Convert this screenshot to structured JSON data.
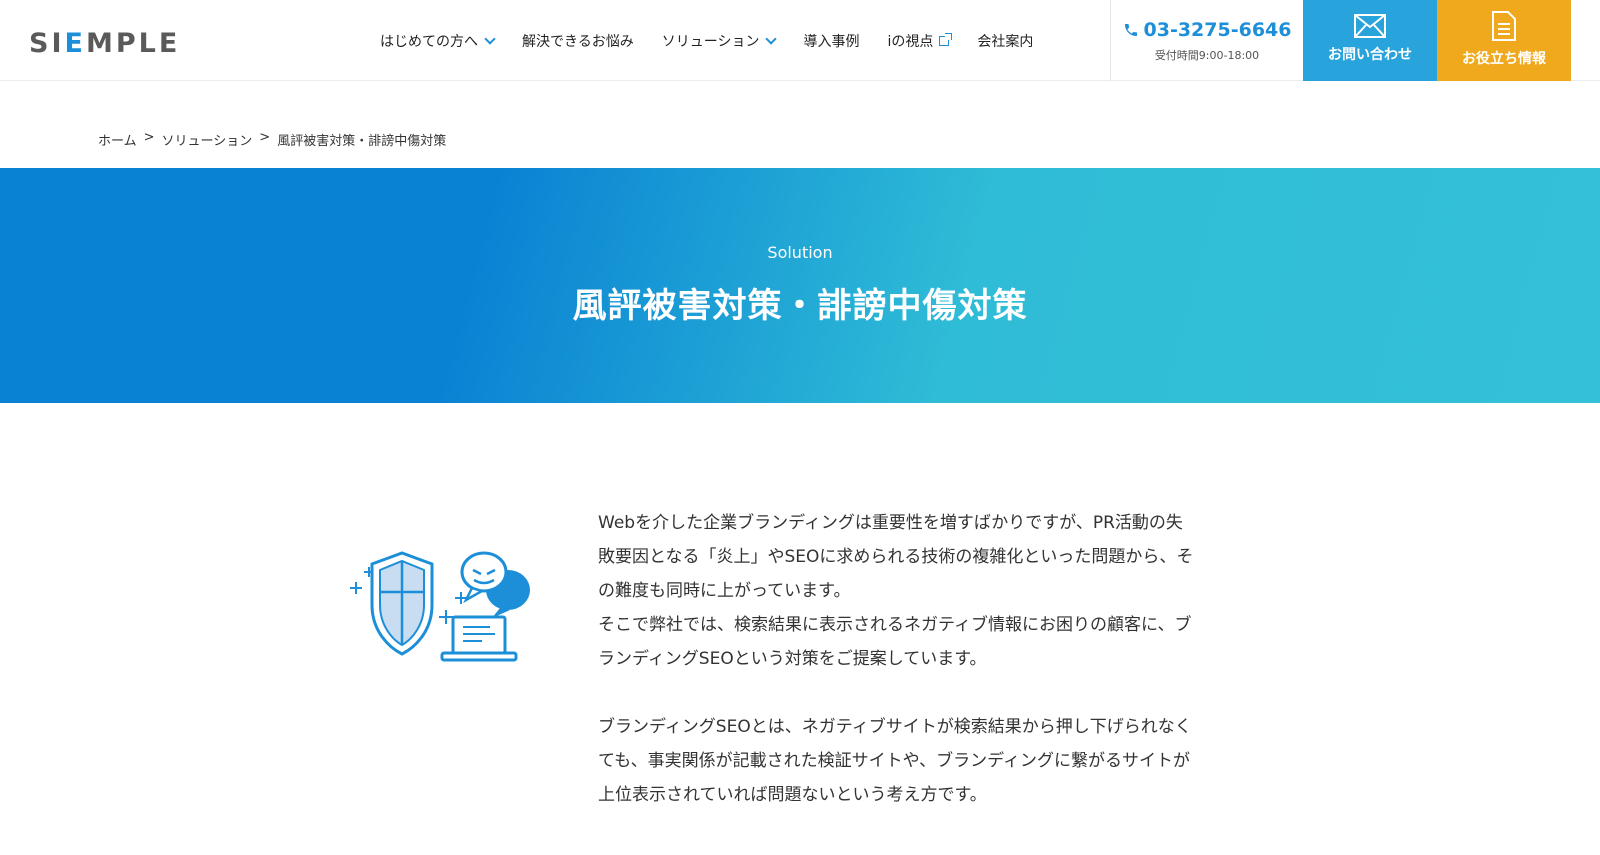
{
  "header": {
    "logo": {
      "pre": "SI",
      "accent": "E",
      "post": "MPLE"
    },
    "nav": [
      {
        "label": "はじめての方へ",
        "has_dropdown": true
      },
      {
        "label": "解決できるお悩み",
        "has_dropdown": false
      },
      {
        "label": "ソリューション",
        "has_dropdown": true
      },
      {
        "label": "導入事例",
        "has_dropdown": false
      },
      {
        "label": "iの視点",
        "external": true
      },
      {
        "label": "会社案内",
        "has_dropdown": false
      }
    ],
    "phone": {
      "number": "03-3275-6646",
      "hours": "受付時間9:00-18:00"
    },
    "contact_label": "お問い合わせ",
    "info_label": "お役立ち情報"
  },
  "breadcrumb": [
    "ホーム",
    "ソリューション",
    "風評被害対策・誹謗中傷対策"
  ],
  "breadcrumb_separator": ">",
  "hero": {
    "subtitle": "Solution",
    "title": "風評被害対策・誹謗中傷対策"
  },
  "body": {
    "paragraph1_lines": [
      "Webを介した企業ブランディングは重要性を増すばかりですが、PR活動の失",
      "敗要因となる「炎上」やSEOに求められる技術の複雑化といった問題から、そ",
      "の難度も同時に上がっています。",
      "そこで弊社では、検索結果に表示されるネガティブ情報にお困りの顧客に、ブ",
      "ランディングSEOという対策をご提案しています。"
    ],
    "paragraph2_lines": [
      "ブランディングSEOとは、ネガティブサイトが検索結果から押し下げられなく",
      "ても、事実関係が記載された検証サイトや、ブランディングに繋がるサイトが",
      "上位表示されていれば問題ないという考え方です。"
    ]
  },
  "colors": {
    "brand_blue": "#1d8fd8",
    "contact_bg": "#29a3dc",
    "info_bg": "#f0a81c",
    "hero_start": "#0a82d4",
    "hero_end": "#34c0d8"
  },
  "icons": [
    "phone-icon",
    "mail-icon",
    "document-icon",
    "chevron-down-icon",
    "external-link-icon",
    "shield-icon",
    "speech-bubble-icon",
    "laptop-icon"
  ]
}
